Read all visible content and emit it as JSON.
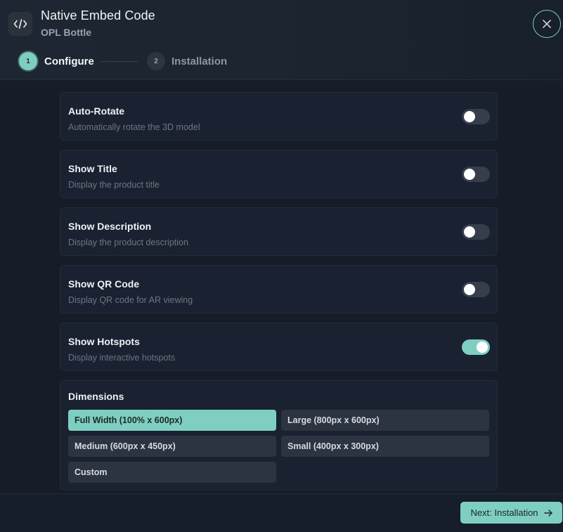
{
  "header": {
    "title": "Native Embed Code",
    "subtitle": "OPL Bottle",
    "icon": "code-icon",
    "close_icon": "close-icon"
  },
  "steps": [
    {
      "number": "1",
      "label": "Configure",
      "active": true
    },
    {
      "number": "2",
      "label": "Installation",
      "active": false
    }
  ],
  "options": [
    {
      "title": "Auto-Rotate",
      "description": "Automatically rotate the 3D model",
      "enabled": false
    },
    {
      "title": "Show Title",
      "description": "Display the product title",
      "enabled": false
    },
    {
      "title": "Show Description",
      "description": "Display the product description",
      "enabled": false
    },
    {
      "title": "Show QR Code",
      "description": "Display QR code for AR viewing",
      "enabled": false
    },
    {
      "title": "Show Hotspots",
      "description": "Display interactive hotspots",
      "enabled": true
    }
  ],
  "dimensions": {
    "title": "Dimensions",
    "choices": [
      {
        "label": "Full Width (100% x 600px)",
        "selected": true
      },
      {
        "label": "Large (800px x 600px)",
        "selected": false
      },
      {
        "label": "Medium (600px x 450px)",
        "selected": false
      },
      {
        "label": "Small (400px x 300px)",
        "selected": false
      },
      {
        "label": "Custom",
        "selected": false
      }
    ]
  },
  "footer": {
    "next_label": "Next: Installation",
    "next_icon": "arrow-right-icon"
  },
  "colors": {
    "accent": "#7ecfc1",
    "background": "#161c28",
    "card": "#1a2130"
  }
}
